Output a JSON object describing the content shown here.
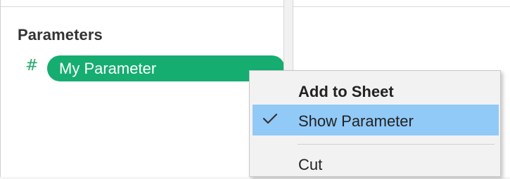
{
  "parameters_panel": {
    "title": "Parameters",
    "items": [
      {
        "type_symbol": "#",
        "label": "My Parameter"
      }
    ]
  },
  "context_menu": {
    "items": [
      {
        "label": "Add to Sheet",
        "style": "heading"
      },
      {
        "label": "Show Parameter",
        "style": "highlighted",
        "checked": true
      },
      {
        "label": "Cut",
        "style": "normal"
      }
    ]
  },
  "colors": {
    "pill": "#16ad71",
    "hash": "#26a86f",
    "highlight": "#91c9f7"
  }
}
